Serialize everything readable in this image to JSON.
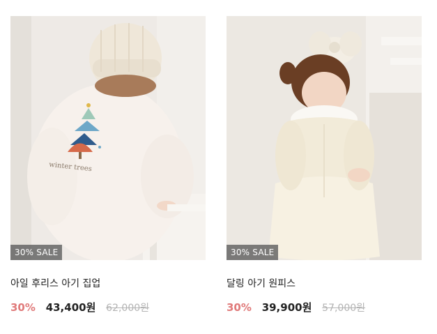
{
  "products": [
    {
      "badge": "30% SALE",
      "name": "아일 후리스 아기 집업",
      "discount": "30%",
      "price": "43,400원",
      "original_price": "62,000원",
      "image_text": "winter trees"
    },
    {
      "badge": "30% SALE",
      "name": "달링 아기 원피스",
      "discount": "30%",
      "price": "39,900원",
      "original_price": "57,000원"
    }
  ],
  "colors": {
    "discount": "#e07a7a",
    "price": "#222222",
    "original_price": "#b3b3b3",
    "badge_bg": "#5a5a5a"
  }
}
